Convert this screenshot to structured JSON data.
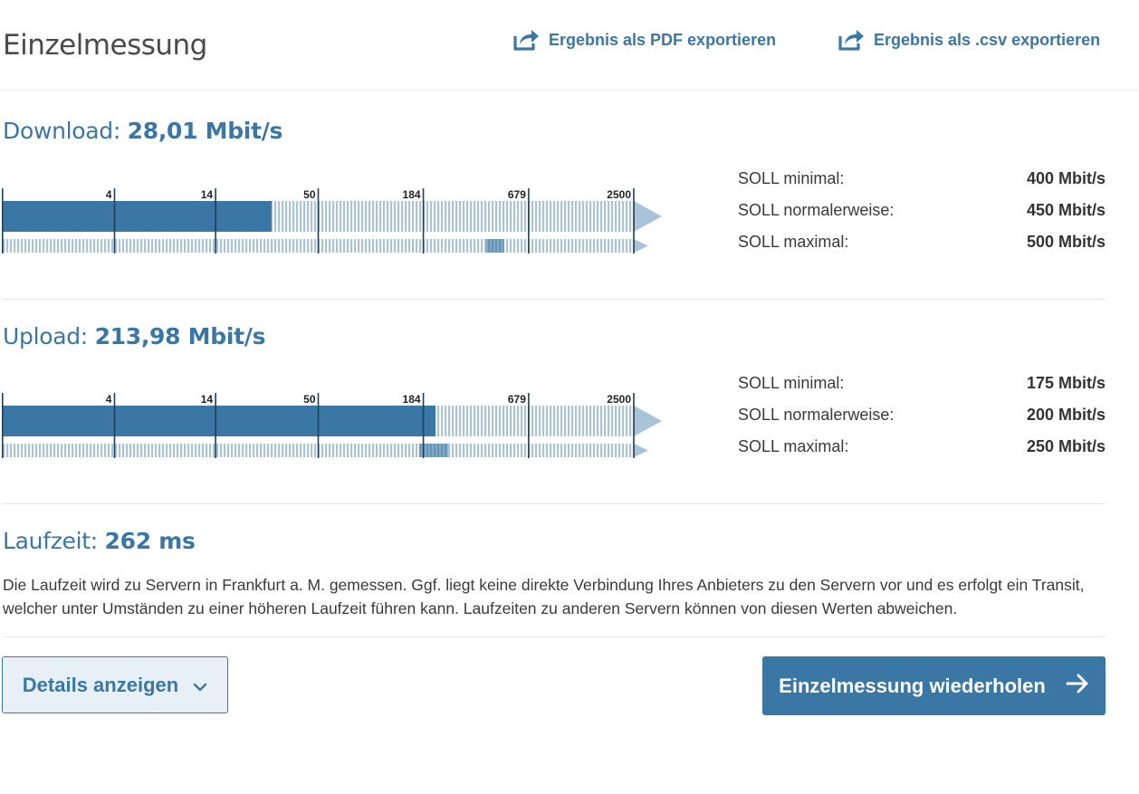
{
  "header": {
    "title": "Einzelmessung",
    "export_pdf": "Ergebnis als PDF exportieren",
    "export_csv": "Ergebnis als .csv exportieren"
  },
  "download": {
    "label": "Download: ",
    "value": "28,01 Mbit/s",
    "scale": {
      "ticks": [
        "4",
        "14",
        "50",
        "184",
        "679",
        "2500"
      ],
      "min": 1,
      "max": 2500,
      "type": "log"
    },
    "measured_mbit": 28.01,
    "soll_min_mbit": 400,
    "soll_max_mbit": 500,
    "soll": [
      {
        "label": "SOLL minimal:",
        "value": "400 Mbit/s"
      },
      {
        "label": "SOLL normalerweise:",
        "value": "450 Mbit/s"
      },
      {
        "label": "SOLL maximal:",
        "value": "500 Mbit/s"
      }
    ]
  },
  "upload": {
    "label": "Upload: ",
    "value": "213,98 Mbit/s",
    "scale": {
      "ticks": [
        "4",
        "14",
        "50",
        "184",
        "679",
        "2500"
      ],
      "min": 1,
      "max": 2500,
      "type": "log"
    },
    "measured_mbit": 213.98,
    "soll_min_mbit": 175,
    "soll_max_mbit": 250,
    "soll": [
      {
        "label": "SOLL minimal:",
        "value": "175 Mbit/s"
      },
      {
        "label": "SOLL normalerweise:",
        "value": "200 Mbit/s"
      },
      {
        "label": "SOLL maximal:",
        "value": "250 Mbit/s"
      }
    ]
  },
  "runtime": {
    "label": "Laufzeit: ",
    "value": "262 ms",
    "description": "Die Laufzeit wird zu Servern in Frankfurt a. M. gemessen. Ggf. liegt keine direkte Verbindung Ihres Anbieters zu den Servern vor und es erfolgt ein Transit, welcher unter Umständen zu einer höheren Laufzeit führen kann. Laufzeiten zu anderen Servern können von diesen Werten abweichen."
  },
  "buttons": {
    "details": "Details anzeigen",
    "repeat": "Einzelmessung wiederholen"
  },
  "colors": {
    "accent": "#3b77a5",
    "bar_dark": "#3b77a5",
    "stripe_light": "#a9c3d8",
    "tick": "#1f3f5c"
  }
}
